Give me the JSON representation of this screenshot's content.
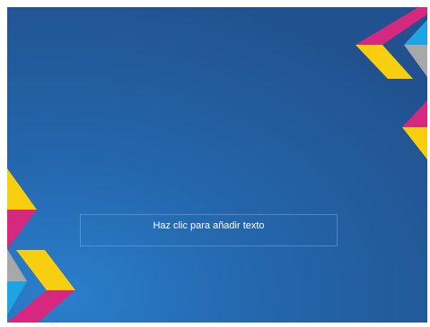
{
  "slide": {
    "placeholder_text": "Haz clic para añadir texto"
  },
  "colors": {
    "background": "#2466ac",
    "magenta": "#d6287f",
    "yellow": "#f7cf0e",
    "cyan": "#1ea3e3",
    "gray": "#a8a8a8"
  },
  "icons": {
    "top_right": "chevron-decoration",
    "right_middle": "chevron-decoration",
    "bottom_left": "chevron-decoration"
  }
}
